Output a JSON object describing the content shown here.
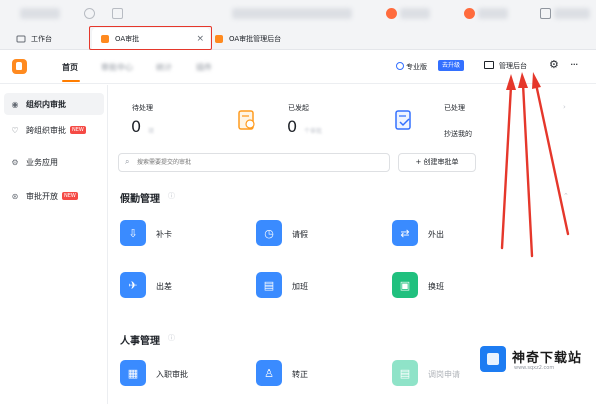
{
  "colors": {
    "accent": "#ff7d00",
    "brand_blue": "#3370ff",
    "annotation_red": "#e5372b"
  },
  "tabs": [
    {
      "label": "工作台",
      "icon": "workspace-icon"
    },
    {
      "label": "OA审批",
      "icon": "oa-icon",
      "close": "×"
    },
    {
      "label": "OA审批管理后台",
      "icon": "oa-admin-icon"
    }
  ],
  "header": {
    "nav": [
      "首页",
      "审批中心",
      "统计",
      "插件"
    ],
    "pro_label": "专业版",
    "upgrade_label": "去升级",
    "admin_label": "管理后台",
    "gear_icon": "⚙",
    "more_icon": "···"
  },
  "sidebar": {
    "items": [
      {
        "label": "组织内审批",
        "icon": "user-icon",
        "active": true
      },
      {
        "label": "跨组织审批",
        "icon": "heart-icon",
        "badge": "NEW"
      },
      {
        "label": "业务应用",
        "icon": "settings-icon"
      },
      {
        "label": "审批开放",
        "icon": "share-icon",
        "badge": "NEW"
      }
    ]
  },
  "stats": {
    "pending_label": "待处理",
    "pending_value": "0",
    "pending_sub": "项",
    "submitted_label": "已发起",
    "submitted_value": "0",
    "submitted_sub": "个审批",
    "processed_label": "已处理",
    "cc_label": "抄送我的"
  },
  "search": {
    "placeholder": "搜索需要提交的审批",
    "create_label": "+ 创建审批单"
  },
  "sections": [
    {
      "title": "假勤管理",
      "apps": [
        {
          "label": "补卡",
          "icon": "clock-in-icon",
          "color": "#3a8bff"
        },
        {
          "label": "请假",
          "icon": "clock-icon",
          "color": "#3a8bff"
        },
        {
          "label": "外出",
          "icon": "outing-icon",
          "color": "#3a8bff"
        },
        {
          "label": "出差",
          "icon": "plane-icon",
          "color": "#3a8bff"
        },
        {
          "label": "加班",
          "icon": "overtime-icon",
          "color": "#3a8bff"
        },
        {
          "label": "换班",
          "icon": "swap-icon",
          "color": "#20c07e"
        }
      ]
    },
    {
      "title": "人事管理",
      "apps": [
        {
          "label": "入职审批",
          "icon": "onboard-icon",
          "color": "#3a8bff"
        },
        {
          "label": "转正",
          "icon": "promotion-icon",
          "color": "#3a8bff"
        },
        {
          "label": "调岗申请",
          "icon": "transfer-icon",
          "color": "#8fe3c8"
        }
      ]
    }
  ],
  "watermark": {
    "title": "神奇下载站",
    "url": "www.sqxz2.com"
  }
}
